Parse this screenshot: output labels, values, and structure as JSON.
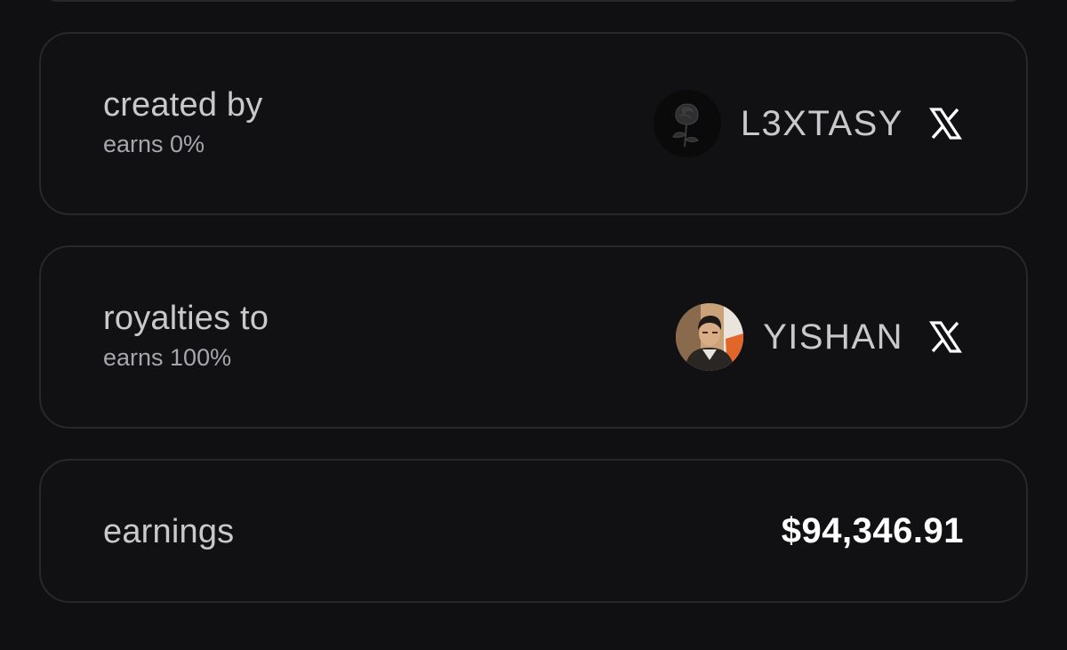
{
  "creator": {
    "title": "created by",
    "earns": "earns 0%",
    "name": "L3XTASY",
    "avatar_icon": "rose-avatar",
    "social_icon": "x-logo-icon"
  },
  "royalties": {
    "title": "royalties to",
    "earns": "earns 100%",
    "name": "YISHAN",
    "avatar_icon": "person-photo-avatar",
    "social_icon": "x-logo-icon"
  },
  "earnings": {
    "title": "earnings",
    "amount": "$94,346.91"
  },
  "colors": {
    "background": "#101012",
    "card_border": "#28282b",
    "text_primary": "#c9c9cc",
    "text_secondary": "#a7a7ab",
    "amount": "#ffffff"
  }
}
